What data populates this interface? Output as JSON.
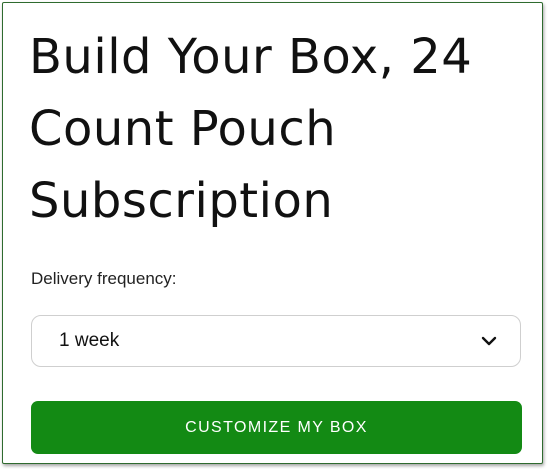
{
  "product": {
    "title": "Build Your Box, 24 Count Pouch Subscription"
  },
  "delivery": {
    "label": "Delivery frequency:",
    "selected": "1 week"
  },
  "cta": {
    "label": "CUSTOMIZE MY BOX"
  },
  "colors": {
    "accent_green": "#138a14",
    "frame_border": "#2f6b2f"
  },
  "icons": {
    "dropdown": "chevron-down-icon"
  }
}
